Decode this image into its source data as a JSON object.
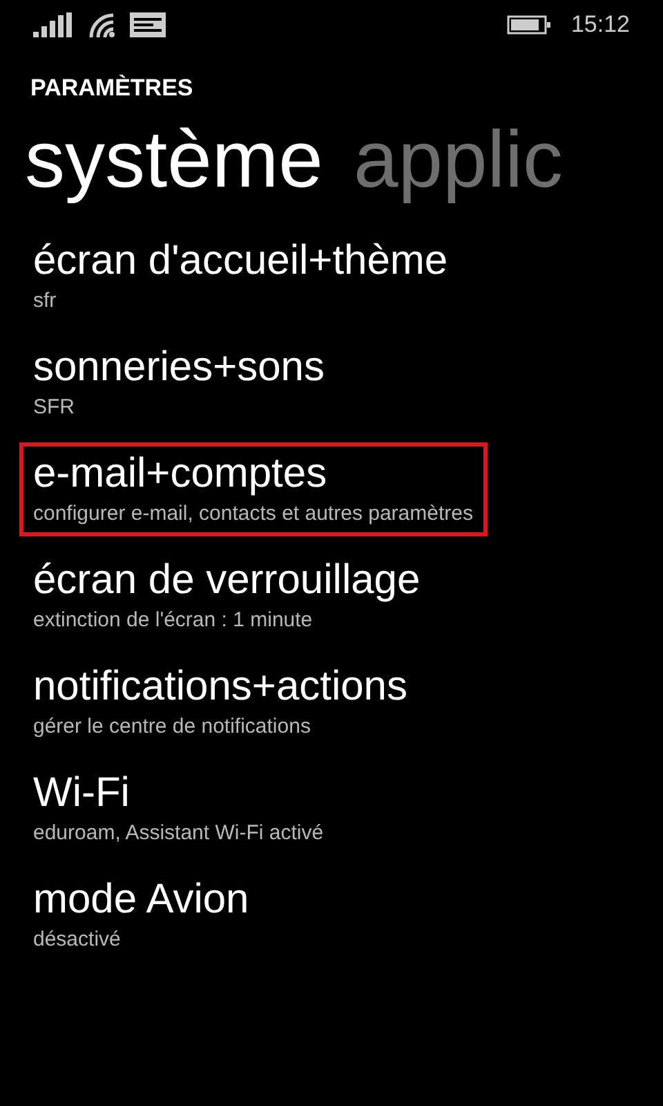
{
  "status_bar": {
    "time": "15:12"
  },
  "header": {
    "title": "PARAMÈTRES"
  },
  "pivots": [
    {
      "label": "système",
      "selected": true
    },
    {
      "label": "applic",
      "selected": false
    }
  ],
  "items": [
    {
      "title": "écran d'accueil+thème",
      "subtitle": "sfr",
      "highlighted": false
    },
    {
      "title": "sonneries+sons",
      "subtitle": "SFR",
      "highlighted": false
    },
    {
      "title": "e-mail+comptes",
      "subtitle": "configurer e-mail, contacts et autres paramètres",
      "highlighted": true
    },
    {
      "title": "écran de verrouillage",
      "subtitle": "extinction de l'écran : 1 minute",
      "highlighted": false
    },
    {
      "title": "notifications+actions",
      "subtitle": "gérer le centre de notifications",
      "highlighted": false
    },
    {
      "title": "Wi-Fi",
      "subtitle": "eduroam, Assistant Wi-Fi activé",
      "highlighted": false
    },
    {
      "title": "mode Avion",
      "subtitle": "désactivé",
      "highlighted": false
    }
  ]
}
